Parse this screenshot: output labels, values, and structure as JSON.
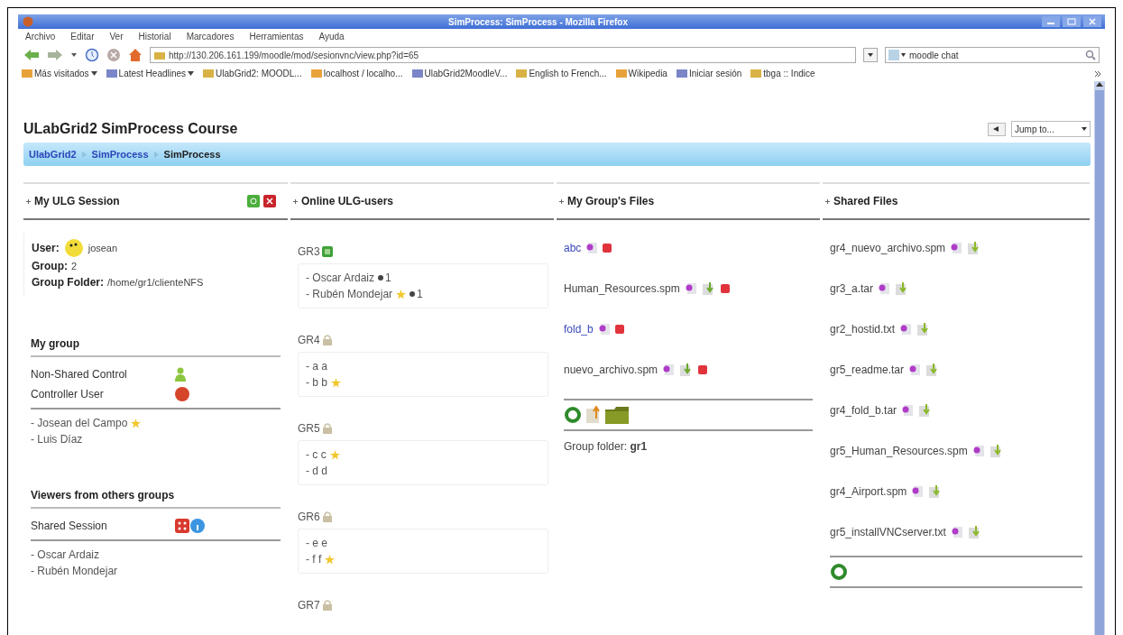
{
  "window": {
    "title": "SimProcess: SimProcess - Mozilla Firefox"
  },
  "menu": [
    "Archivo",
    "Editar",
    "Ver",
    "Historial",
    "Marcadores",
    "Herramientas",
    "Ayuda"
  ],
  "address": {
    "value": "http://130.206.161.199/moodle/mod/sesionvnc/view.php?id=65"
  },
  "search": {
    "value": "moodle chat"
  },
  "bookmarks": [
    {
      "label": "Más visitados",
      "menu": true
    },
    {
      "label": "Latest Headlines",
      "menu": true
    },
    {
      "label": "UlabGrid2: MOODL...",
      "menu": false
    },
    {
      "label": "localhost / localho...",
      "menu": false
    },
    {
      "label": "UlabGrid2MoodleV...",
      "menu": false
    },
    {
      "label": "English to French...",
      "menu": false
    },
    {
      "label": "Wikipedia",
      "menu": false
    },
    {
      "label": "Iniciar sesión",
      "menu": false
    },
    {
      "label": "tbga :: Indice",
      "menu": false
    }
  ],
  "page": {
    "title": "ULabGrid2 SimProcess Course",
    "jump": {
      "value": "Jump to..."
    },
    "breadcrumb": [
      {
        "label": "UlabGrid2",
        "link": true
      },
      {
        "label": "SimProcess",
        "link": true
      },
      {
        "label": "SimProcess",
        "link": false
      }
    ]
  },
  "session": {
    "heading": "My ULG Session",
    "fields": [
      {
        "label": "User:",
        "value": "josean",
        "kind": "user"
      },
      {
        "label": "Group:",
        "value": "2",
        "kind": "text"
      },
      {
        "label": "Group Folder:",
        "value": "/home/gr1/clienteNFS",
        "kind": "text"
      }
    ],
    "sections": [
      {
        "heading": "My group",
        "legend": [
          {
            "label": "Non-Shared Control",
            "kind": "person"
          },
          {
            "label": "Controller User",
            "kind": "controller"
          }
        ],
        "members": [
          {
            "name": "- Josean del Campo",
            "star": true
          },
          {
            "name": "- Luis Díaz",
            "star": false
          }
        ]
      },
      {
        "heading": "Viewers from others groups",
        "legend": [
          {
            "label": "Shared Session",
            "kind": "shared"
          }
        ],
        "members": [
          {
            "name": "- Oscar Ardaiz",
            "star": false
          },
          {
            "name": "- Rubén Mondejar",
            "star": false
          }
        ]
      }
    ]
  },
  "online": {
    "heading": "Online ULG-users",
    "groups": [
      {
        "name": "GR3",
        "open": true,
        "members": [
          {
            "name": "- Oscar Ardaiz",
            "star": false,
            "count": "1"
          },
          {
            "name": "- Rubén Mondejar",
            "star": true,
            "count": "1"
          }
        ]
      },
      {
        "name": "GR4",
        "open": false,
        "members": [
          {
            "name": "- a a",
            "star": false
          },
          {
            "name": "- b b",
            "star": true
          }
        ]
      },
      {
        "name": "GR5",
        "open": false,
        "members": [
          {
            "name": "- c c",
            "star": true
          },
          {
            "name": "- d d",
            "star": false
          }
        ]
      },
      {
        "name": "GR6",
        "open": false,
        "members": [
          {
            "name": "- e e",
            "star": false
          },
          {
            "name": "- f f",
            "star": true
          }
        ]
      },
      {
        "name": "GR7",
        "open": false
      }
    ]
  },
  "group_files": {
    "heading": "My Group's Files",
    "files": [
      {
        "name": "abc",
        "kind": "folder"
      },
      {
        "name": "Human_Resources.spm",
        "kind": "file"
      },
      {
        "name": "fold_b",
        "kind": "folder"
      },
      {
        "name": "nuevo_archivo.spm",
        "kind": "file"
      }
    ],
    "folder": "Group folder: **gr1**"
  },
  "shared_files": {
    "heading": "Shared Files",
    "files": [
      "gr4_nuevo_archivo.spm",
      "gr3_a.tar",
      "gr2_hostid.txt",
      "gr5_readme.tar",
      "gr4_fold_b.tar",
      "gr5_Human_Resources.spm",
      "gr4_Airport.spm",
      "gr5_installVNCserver.txt"
    ]
  }
}
